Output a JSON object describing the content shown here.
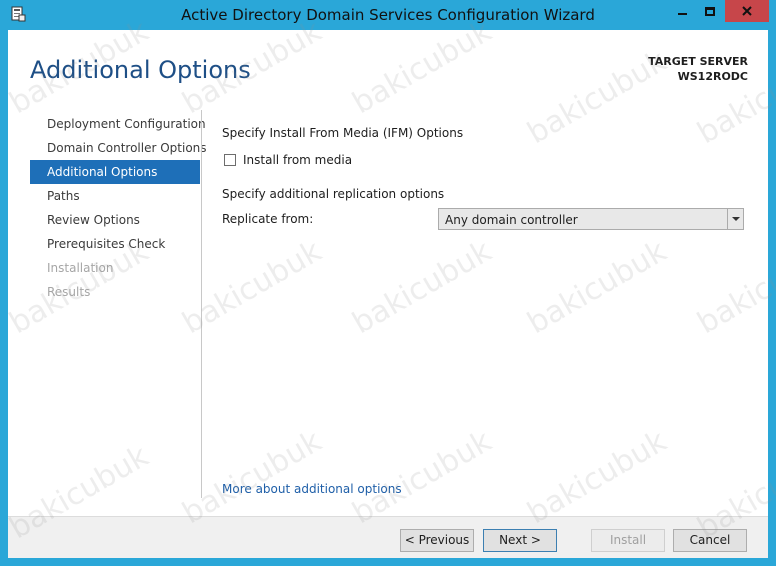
{
  "window": {
    "title": "Active Directory Domain Services Configuration Wizard",
    "app_icon": "server-wizard-icon"
  },
  "header": {
    "page_title": "Additional Options",
    "target_server_label": "TARGET SERVER",
    "target_server_name": "WS12RODC"
  },
  "nav": {
    "items": [
      {
        "label": "Deployment Configuration",
        "state": "normal"
      },
      {
        "label": "Domain Controller Options",
        "state": "normal"
      },
      {
        "label": "Additional Options",
        "state": "active"
      },
      {
        "label": "Paths",
        "state": "normal"
      },
      {
        "label": "Review Options",
        "state": "normal"
      },
      {
        "label": "Prerequisites Check",
        "state": "normal"
      },
      {
        "label": "Installation",
        "state": "disabled"
      },
      {
        "label": "Results",
        "state": "disabled"
      }
    ]
  },
  "main": {
    "ifm_heading": "Specify Install From Media (IFM) Options",
    "install_from_media_label": "Install from media",
    "install_from_media_checked": false,
    "replication_heading": "Specify additional replication options",
    "replicate_from_label": "Replicate from:",
    "replicate_from_value": "Any domain controller",
    "more_link": "More about additional options"
  },
  "footer": {
    "previous": "< Previous",
    "next": "Next >",
    "install": "Install",
    "cancel": "Cancel"
  },
  "watermark_text": "bakicubuk",
  "colors": {
    "title_bar": "#2aa7d8",
    "accent": "#1e6fb8",
    "page_title": "#1e4f86",
    "close_button": "#c7464a"
  }
}
